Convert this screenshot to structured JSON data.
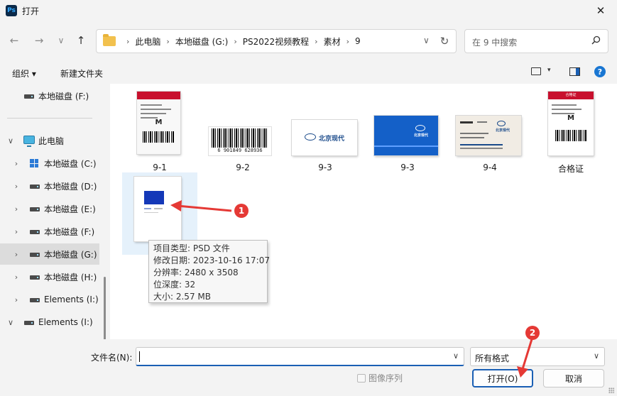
{
  "window": {
    "title": "打开",
    "app_icon": "Ps",
    "close_glyph": "✕"
  },
  "nav": {
    "back": "←",
    "forward": "→",
    "recent": "∨",
    "up": "↑"
  },
  "address": {
    "crumbs": [
      "此电脑",
      "本地磁盘 (G:)",
      "PS2022视频教程",
      "素材",
      "9"
    ],
    "chevron": "∨",
    "refresh": "↻"
  },
  "search": {
    "placeholder": "在 9 中搜索",
    "icon": "⌕"
  },
  "toolbar": {
    "organize": "组织 ▾",
    "new_folder": "新建文件夹",
    "view_chev": "▾",
    "help": "?"
  },
  "sidebar": {
    "items": [
      {
        "label": "本地磁盘 (F:)"
      },
      {
        "label": "此电脑"
      },
      {
        "label": "本地磁盘 (C:)"
      },
      {
        "label": "本地磁盘 (D:)"
      },
      {
        "label": "本地磁盘 (E:)"
      },
      {
        "label": "本地磁盘 (F:)"
      },
      {
        "label": "本地磁盘 (G:)"
      },
      {
        "label": "本地磁盘 (H:)"
      },
      {
        "label": "Elements (I:)"
      },
      {
        "label": "Elements (I:)"
      }
    ]
  },
  "files": [
    {
      "name": "9-1",
      "kind": "cert"
    },
    {
      "name": "9-2",
      "kind": "barcode",
      "digits": "6 901849 628936"
    },
    {
      "name": "9-3",
      "kind": "hyundai-white",
      "text": "北京现代"
    },
    {
      "name": "9-3",
      "kind": "hyundai-blue",
      "text": "北京现代"
    },
    {
      "name": "9-4",
      "kind": "business-card",
      "text": "北京现代"
    },
    {
      "name": "合格证",
      "kind": "cert",
      "header": "合格证",
      "size": "M"
    },
    {
      "name": "",
      "kind": "psd"
    }
  ],
  "tooltip": {
    "lines": [
      "项目类型: PSD 文件",
      "修改日期: 2023-10-16 17:07",
      "分辨率: 2480 x 3508",
      "位深度: 32",
      "大小: 2.57 MB"
    ]
  },
  "annotations": {
    "badge1": "1",
    "badge2": "2",
    "color": "#e53935"
  },
  "footer": {
    "filename_label": "文件名(N):",
    "filename_value": "",
    "dropdown_glyph": "∨",
    "filetype": "所有格式",
    "image_sequence": "图像序列",
    "open": "打开(O)",
    "cancel": "取消"
  }
}
